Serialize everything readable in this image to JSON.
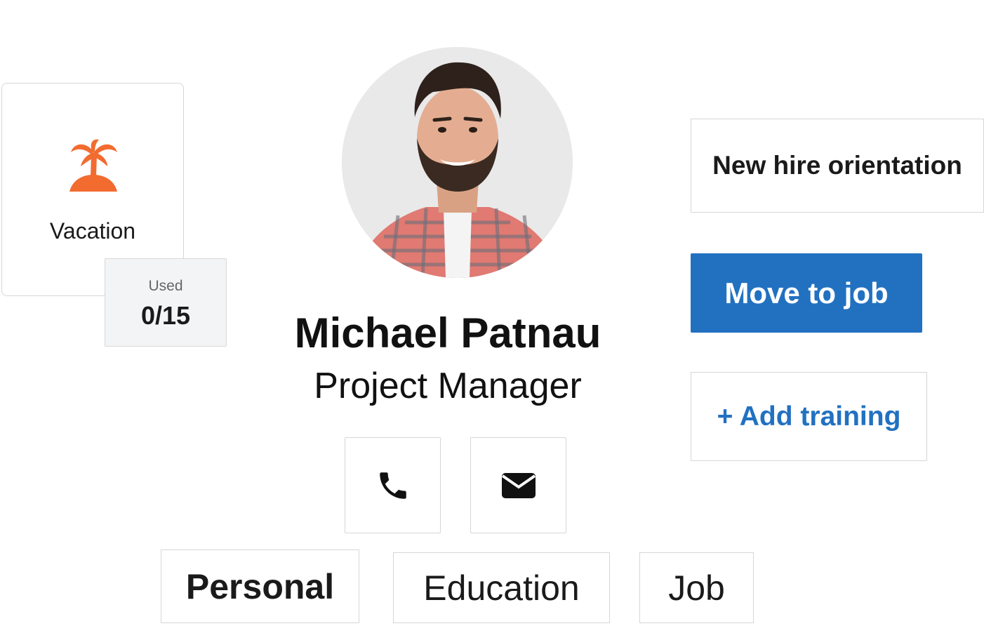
{
  "vacation": {
    "label": "Vacation",
    "icon": "palm-tree-icon",
    "icon_color": "#f26b2f",
    "used_label": "Used",
    "used_value": "0/15"
  },
  "profile": {
    "name": "Michael Patnau",
    "title": "Project Manager",
    "avatar": "profile-photo"
  },
  "contact": {
    "phone_icon": "phone-icon",
    "email_icon": "envelope-icon"
  },
  "actions": {
    "orientation_label": "New hire orientation",
    "move_label": "Move to job",
    "training_label": "+ Add training",
    "accent_color": "#2271c1"
  },
  "tabs": [
    {
      "label": "Personal",
      "active": true
    },
    {
      "label": "Education",
      "active": false
    },
    {
      "label": "Job",
      "active": false
    }
  ]
}
